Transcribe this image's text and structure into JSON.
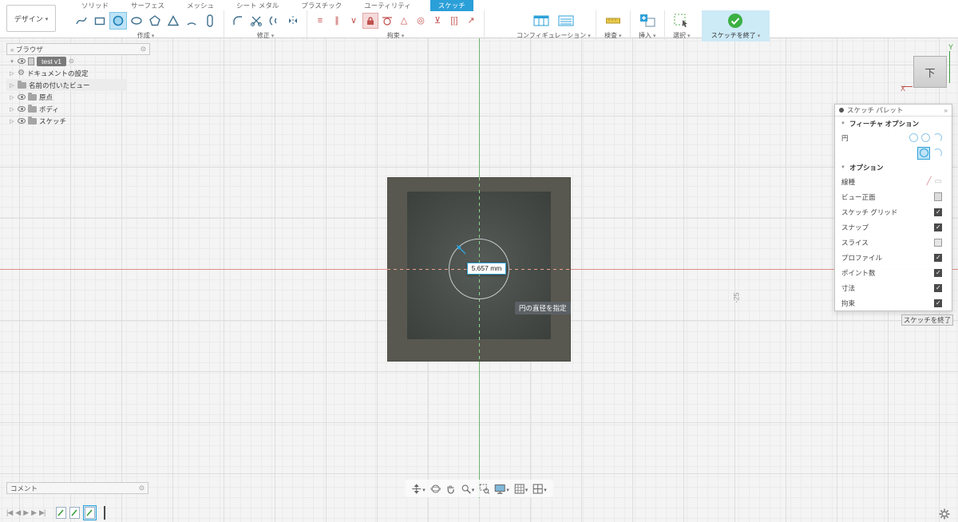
{
  "topbar": {
    "design_label": "デザイン",
    "tabs": [
      {
        "label": "ソリッド"
      },
      {
        "label": "サーフェス"
      },
      {
        "label": "メッシュ"
      },
      {
        "label": "シート メタル"
      },
      {
        "label": "プラスチック"
      },
      {
        "label": "ユーティリティ"
      },
      {
        "label": "スケッチ"
      }
    ],
    "groups": {
      "create": "作成",
      "modify": "修正",
      "constrain": "拘束",
      "config": "コンフィギュレーション",
      "inspect": "検査",
      "insert": "挿入",
      "select": "選択"
    },
    "finish_label": "スケッチを終了"
  },
  "browser": {
    "title": "ブラウザ",
    "items": [
      {
        "label": "test v1"
      },
      {
        "label": "ドキュメントの設定"
      },
      {
        "label": "名前の付いたビュー"
      },
      {
        "label": "原点"
      },
      {
        "label": "ボディ"
      },
      {
        "label": "スケッチ"
      }
    ]
  },
  "palette": {
    "title": "スケッチ パレット",
    "feature_section": "フィーチャ オプション",
    "circle_label": "円",
    "options_section": "オプション",
    "option_rows": [
      {
        "label": "線種"
      },
      {
        "label": "ビュー正面"
      },
      {
        "label": "スケッチ グリッド",
        "checked": true
      },
      {
        "label": "スナップ",
        "checked": true
      },
      {
        "label": "スライス",
        "checked": false
      },
      {
        "label": "プロファイル",
        "checked": true
      },
      {
        "label": "ポイント数",
        "checked": true
      },
      {
        "label": "寸法",
        "checked": true
      },
      {
        "label": "拘束",
        "checked": true
      }
    ],
    "finish_button": "スケッチを終了"
  },
  "viewcube": {
    "face": "下",
    "axis_x": "X",
    "axis_y": "Y"
  },
  "canvas": {
    "dimension_value": "5.657 mm",
    "tooltip": "円の直径を指定",
    "grid_label": "-25"
  },
  "bottom": {
    "comment_label": "コメント"
  }
}
